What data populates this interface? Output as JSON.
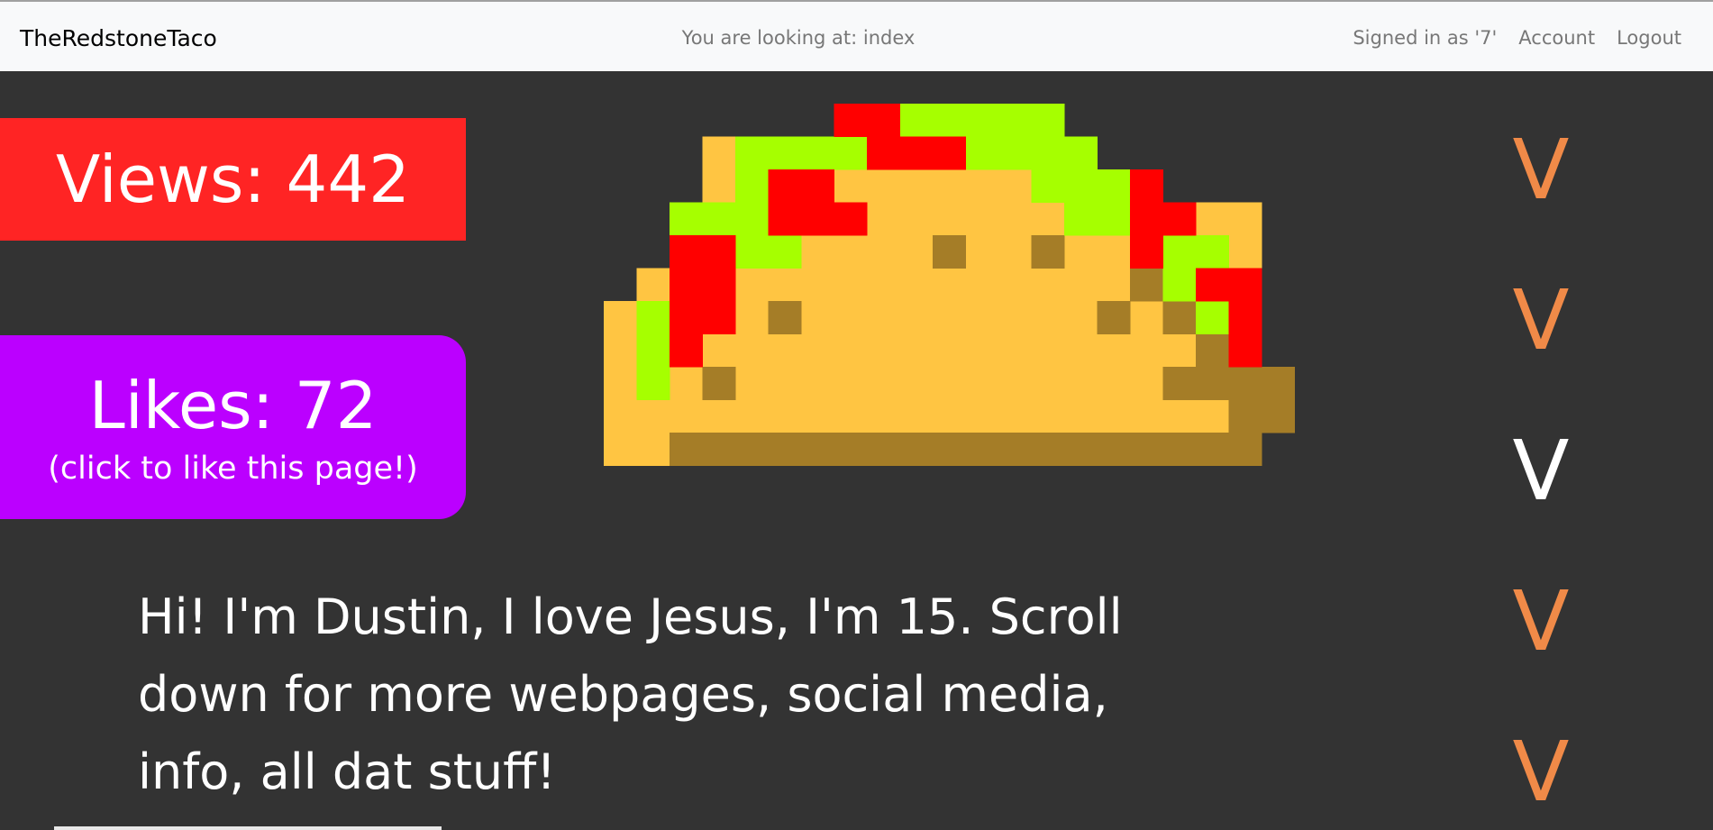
{
  "navbar": {
    "brand": "TheRedstoneTaco",
    "location": "You are looking at: index",
    "signed_in": "Signed in as '7'",
    "account": "Account",
    "logout": "Logout"
  },
  "stats": {
    "views": "Views: 442",
    "likes": "Likes: 72",
    "likes_hint": "(click to like this page!)"
  },
  "taco_image": {
    "icon": "pixel-taco-icon",
    "colors": {
      "shell": "#ffc542",
      "shade": "#a57d27",
      "lettuce": "#a6ff00",
      "tomato": "#ff0000"
    }
  },
  "scroll_arrows": {
    "labels": [
      "V",
      "V",
      "V",
      "V",
      "V"
    ],
    "colors": {
      "normal": "#f08a48",
      "active": "#ffffff"
    }
  },
  "intro": {
    "text": "Hi! I'm Dustin, I love Jesus, I'm 15. Scroll down for more webpages, social media, info, all dat stuff!"
  },
  "colors": {
    "background": "#333333",
    "navbar": "#f8f9fa",
    "views_box": "#ff2424",
    "likes_box": "#bb00ff"
  }
}
